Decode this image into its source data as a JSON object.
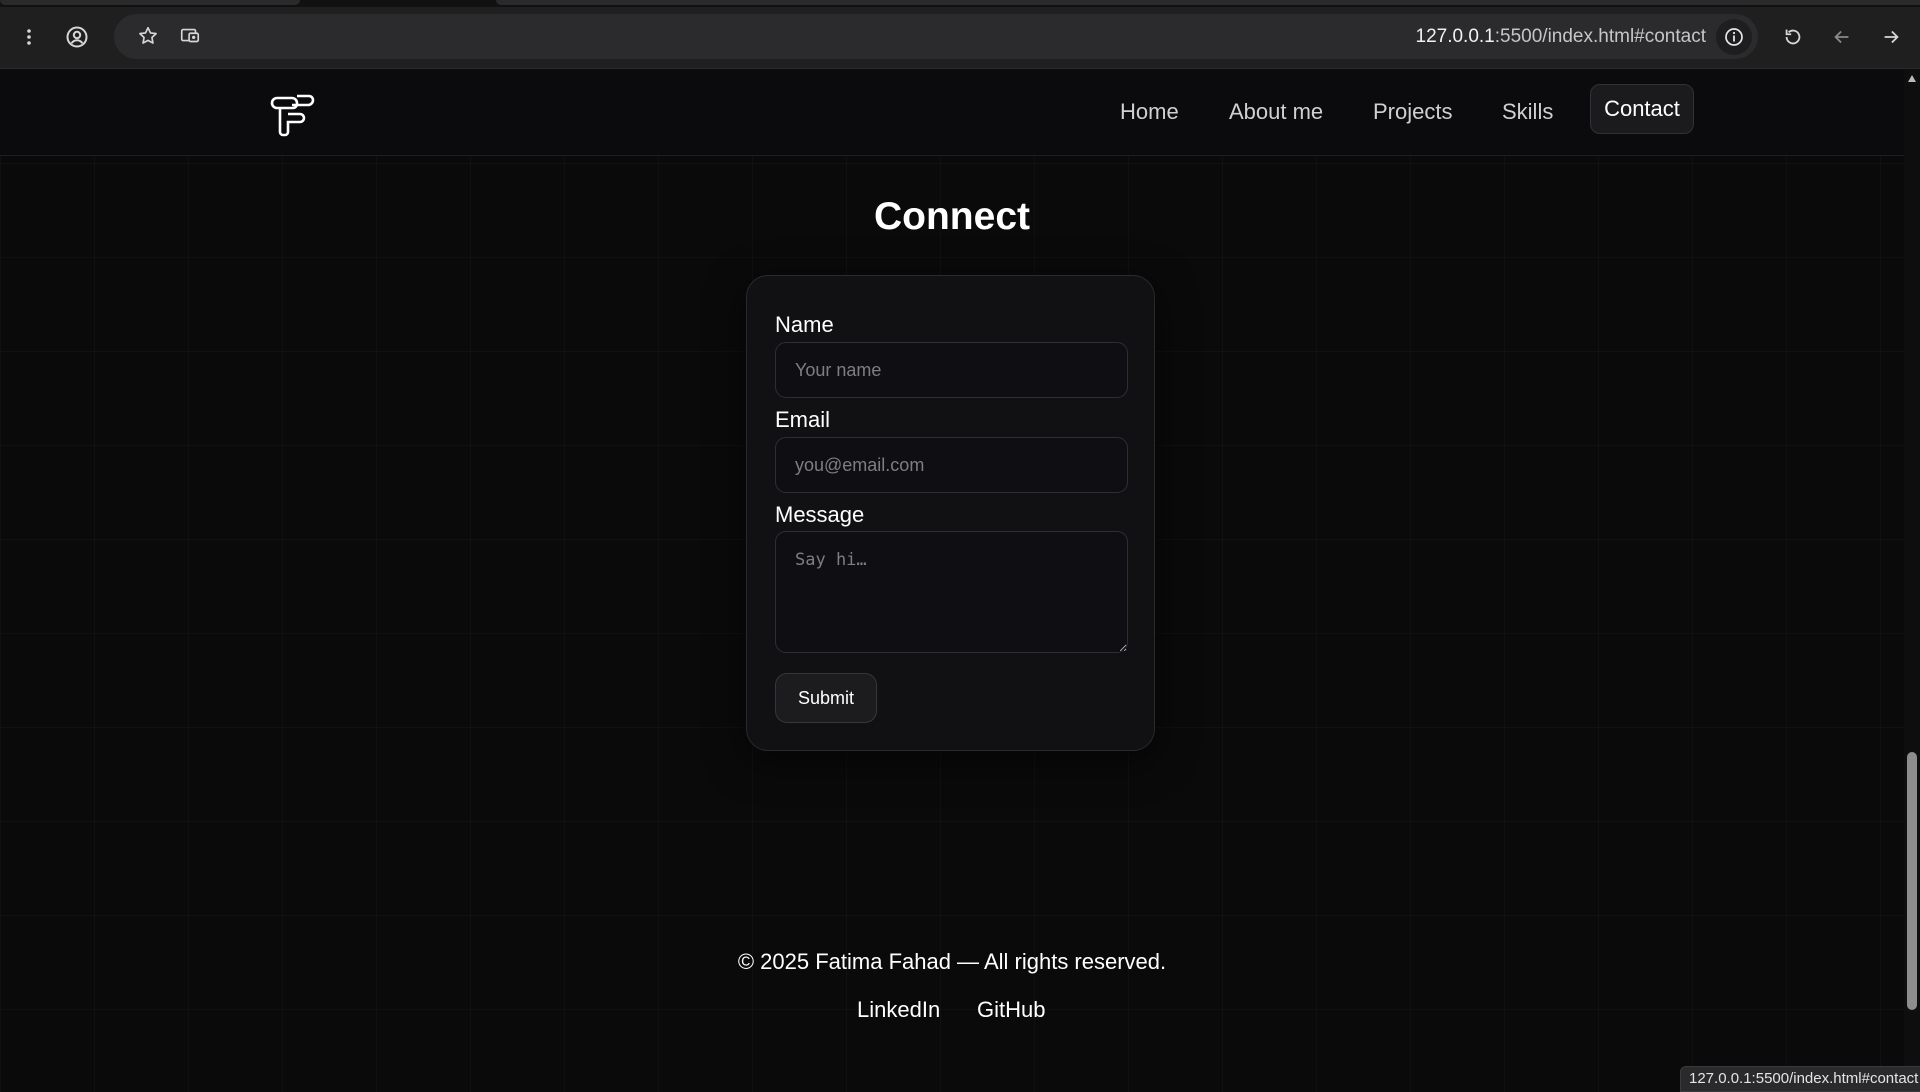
{
  "browser": {
    "url_host": "127.0.0.1",
    "url_rest": ":5500/index.html#contact",
    "status_url": "127.0.0.1:5500/index.html#contact",
    "icons": [
      "more-vert-icon",
      "account-icon",
      "star-icon",
      "cast-icon",
      "info-icon",
      "reload-icon",
      "back-icon",
      "forward-icon"
    ]
  },
  "nav": {
    "items": [
      {
        "label": "Home"
      },
      {
        "label": "About me"
      },
      {
        "label": "Projects"
      },
      {
        "label": "Skills"
      },
      {
        "label": "Contact",
        "active": true
      }
    ]
  },
  "contact": {
    "title": "Connect",
    "name_label": "Name",
    "name_placeholder": "Your name",
    "email_label": "Email",
    "email_placeholder": "you@email.com",
    "message_label": "Message",
    "message_placeholder": "Say hi…",
    "submit_label": "Submit"
  },
  "footer": {
    "copyright": "© 2025 Fatima Fahad — All rights reserved.",
    "links": [
      {
        "label": "LinkedIn"
      },
      {
        "label": "GitHub"
      }
    ]
  },
  "colors": {
    "background": "#0a0a0b",
    "card": "#111113",
    "text": "#ffffff",
    "muted": "#7d7d84"
  }
}
